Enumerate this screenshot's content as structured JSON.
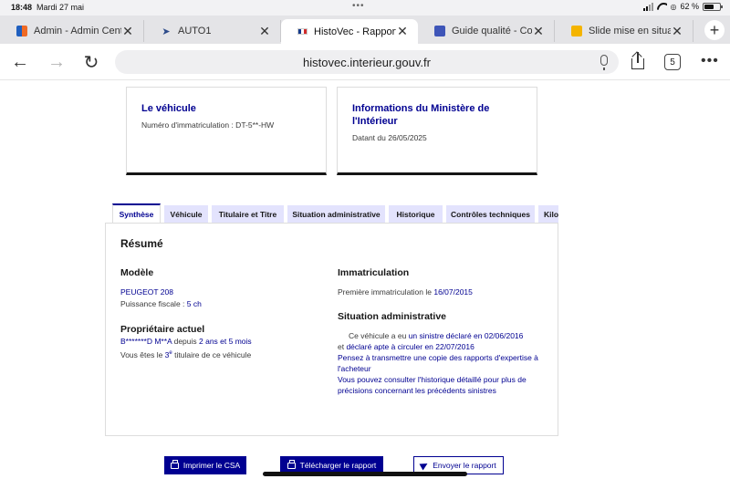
{
  "status": {
    "time": "18:48",
    "date": "Mardi 27 mai",
    "dots": "•••",
    "battery": "62 %",
    "battery_level": 0.62
  },
  "tabs": [
    {
      "title": "Admin - Admin Cent",
      "icon": "admin-favicon",
      "active": false
    },
    {
      "title": "AUTO1",
      "icon": "auto1-favicon",
      "active": false
    },
    {
      "title": "HistoVec - Rapport v",
      "icon": "french-flag-favicon",
      "active": true
    },
    {
      "title": "Guide qualité - Com",
      "icon": "document-favicon",
      "active": false
    },
    {
      "title": "Slide mise en situat",
      "icon": "slides-favicon",
      "active": false
    }
  ],
  "toolbar": {
    "url": "histovec.interieur.gouv.fr",
    "tab_count": "5",
    "new_tab": "+",
    "more": "•••"
  },
  "cards": {
    "vehicle": {
      "title": "Le véhicule",
      "text": "Numéro d'immatriculation : DT-5**-HW"
    },
    "ministry": {
      "title": "Informations du Ministère de l'Intérieur",
      "text": "Datant du 26/05/2025"
    }
  },
  "page_tabs": [
    "Synthèse",
    "Véhicule",
    "Titulaire et Titre",
    "Situation administrative",
    "Historique",
    "Contrôles techniques",
    "Kilométrage"
  ],
  "summary": {
    "title": "Résumé",
    "model_heading": "Modèle",
    "model_value": "PEUGEOT 208",
    "fiscal_label": "Puissance fiscale : ",
    "fiscal_value": "5 ch",
    "owner_heading": "Propriétaire actuel",
    "owner_name": "B*******D M**A",
    "owner_since_label": " depuis ",
    "owner_since_value": "2 ans et 5 mois",
    "holder_prefix": "Vous êtes le ",
    "holder_rank": "3",
    "holder_rank_sup": "e",
    "holder_suffix": " titulaire de ce véhicule",
    "immat_heading": "Immatriculation",
    "first_immat_label": "Première immatriculation le ",
    "first_immat_date": "16/07/2015",
    "admin_heading": "Situation administrative",
    "admin_line1_prefix": "Ce véhicule a eu ",
    "admin_line1_link": "un sinistre déclaré en 02/06/2016",
    "admin_line2_prefix": "et ",
    "admin_line2_link": "déclaré apte à circuler en 22/07/2016",
    "admin_line3": "Pensez à transmettre une copie des rapports d'expertise à l'acheteur",
    "admin_line4": "Vous pouvez consulter l'historique détaillé pour plus de précisions concernant les précédents sinistres"
  },
  "actions": {
    "print": "Imprimer le CSA",
    "download": "Télécharger le rapport",
    "send": "Envoyer le rapport"
  }
}
